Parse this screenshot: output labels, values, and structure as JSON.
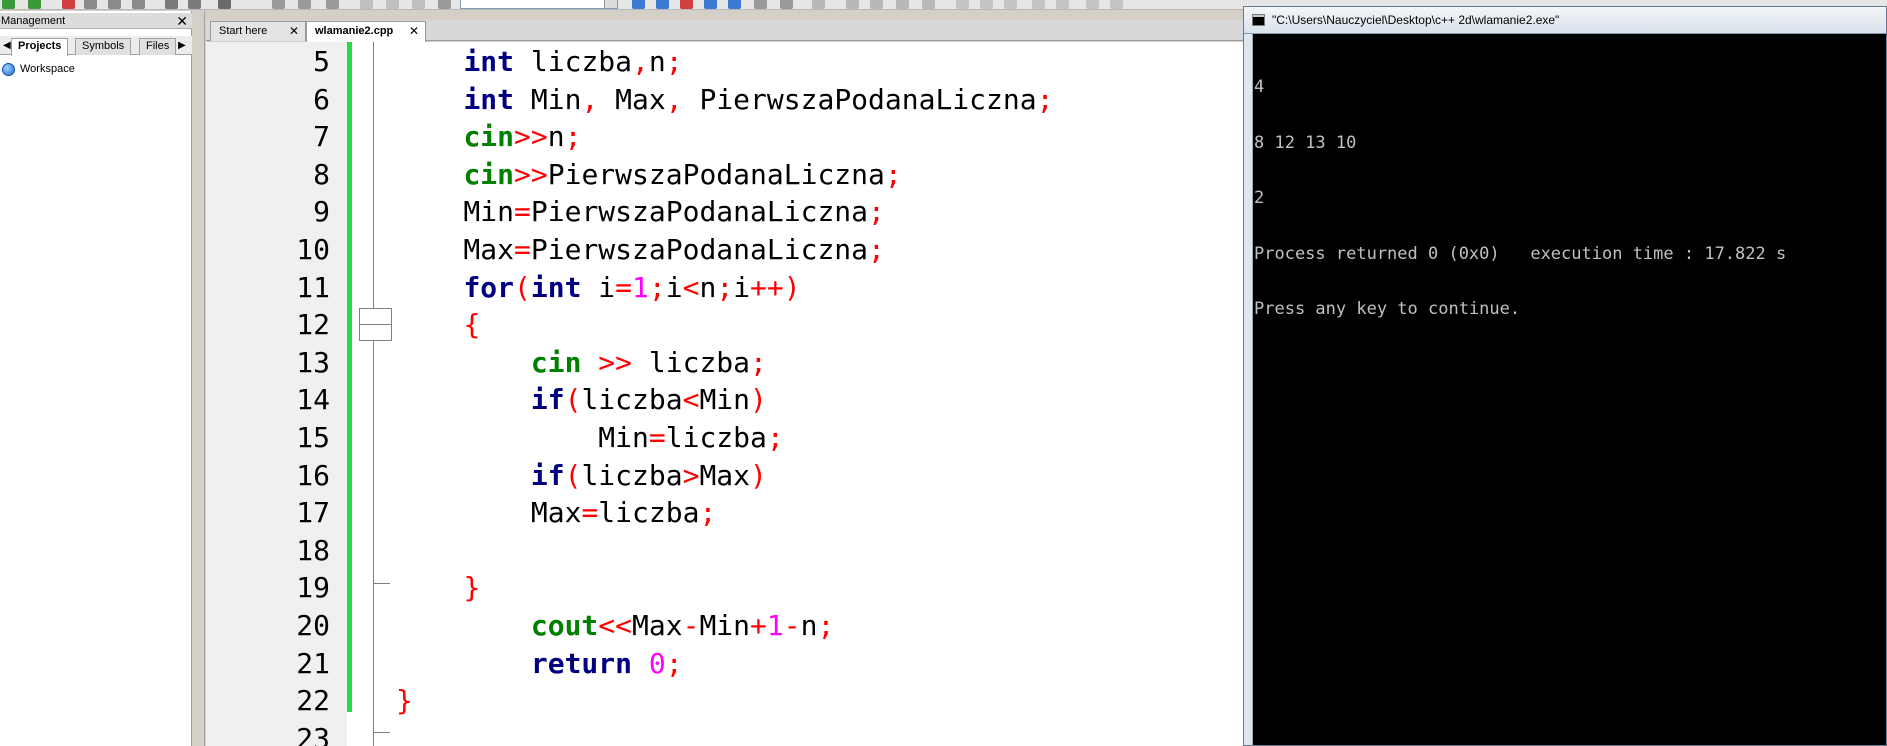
{
  "management": {
    "title": "Management",
    "close": "✕",
    "tabs": [
      "Projects",
      "Symbols",
      "Files"
    ],
    "active_tab": "Projects",
    "tree": [
      {
        "label": "Workspace",
        "icon": "workspace-icon"
      }
    ]
  },
  "editor_tabs": [
    {
      "label": "Start here",
      "active": false
    },
    {
      "label": "wlamanie2.cpp",
      "active": true
    }
  ],
  "editor_lines": [
    {
      "num": "5",
      "html": "    <span class=\"kw\">int</span> liczba<span class=\"op\">,</span>n<span class=\"op\">;</span>"
    },
    {
      "num": "6",
      "html": "    <span class=\"kw\">int</span> Min<span class=\"op\">,</span> Max<span class=\"op\">,</span> PierwszaPodanaLiczna<span class=\"op\">;</span>"
    },
    {
      "num": "7",
      "html": "    <span class=\"io\">cin</span><span class=\"op\">&gt;&gt;</span>n<span class=\"op\">;</span>"
    },
    {
      "num": "8",
      "html": "    <span class=\"io\">cin</span><span class=\"op\">&gt;&gt;</span>PierwszaPodanaLiczna<span class=\"op\">;</span>"
    },
    {
      "num": "9",
      "html": "    Min<span class=\"op\">=</span>PierwszaPodanaLiczna<span class=\"op\">;</span>"
    },
    {
      "num": "10",
      "html": "    Max<span class=\"op\">=</span>PierwszaPodanaLiczna<span class=\"op\">;</span>"
    },
    {
      "num": "11",
      "html": "    <span class=\"kw\">for</span><span class=\"op\">(</span><span class=\"kw\">int</span> i<span class=\"op\">=</span><span class=\"num\">1</span><span class=\"op\">;</span>i<span class=\"op\">&lt;</span>n<span class=\"op\">;</span>i<span class=\"op\">++)</span>"
    },
    {
      "num": "12",
      "html": "    <span class=\"op\">{</span>"
    },
    {
      "num": "13",
      "html": "        <span class=\"io\">cin</span> <span class=\"op\">&gt;&gt;</span> liczba<span class=\"op\">;</span>"
    },
    {
      "num": "14",
      "html": "        <span class=\"kw\">if</span><span class=\"op\">(</span>liczba<span class=\"op\">&lt;</span>Min<span class=\"op\">)</span>"
    },
    {
      "num": "15",
      "html": "            Min<span class=\"op\">=</span>liczba<span class=\"op\">;</span>"
    },
    {
      "num": "16",
      "html": "        <span class=\"kw\">if</span><span class=\"op\">(</span>liczba<span class=\"op\">&gt;</span>Max<span class=\"op\">)</span>"
    },
    {
      "num": "17",
      "html": "        Max<span class=\"op\">=</span>liczba<span class=\"op\">;</span>"
    },
    {
      "num": "18",
      "html": ""
    },
    {
      "num": "19",
      "html": "    <span class=\"op\">}</span>"
    },
    {
      "num": "20",
      "html": "        <span class=\"io\">cout</span><span class=\"op\">&lt;&lt;</span>Max<span class=\"op\">-</span>Min<span class=\"op\">+</span><span class=\"num\">1</span><span class=\"op\">-</span>n<span class=\"op\">;</span>"
    },
    {
      "num": "21",
      "html": "        <span class=\"kw\">return</span> <span class=\"num\">0</span><span class=\"op\">;</span>"
    },
    {
      "num": "22",
      "html": "<span class=\"op\">}</span>"
    },
    {
      "num": "23",
      "html": ""
    }
  ],
  "console": {
    "title": "\"C:\\Users\\Nauczyciel\\Desktop\\c++ 2d\\wlamanie2.exe\"",
    "lines": [
      "4",
      "8 12 13 10",
      "2",
      "Process returned 0 (0x0)   execution time : 17.822 s",
      "Press any key to continue."
    ]
  },
  "colors": {
    "keyword": "#000080",
    "io": "#008000",
    "operator": "#ff0000",
    "number": "#ff00ff",
    "change_bar": "#22dd44"
  }
}
